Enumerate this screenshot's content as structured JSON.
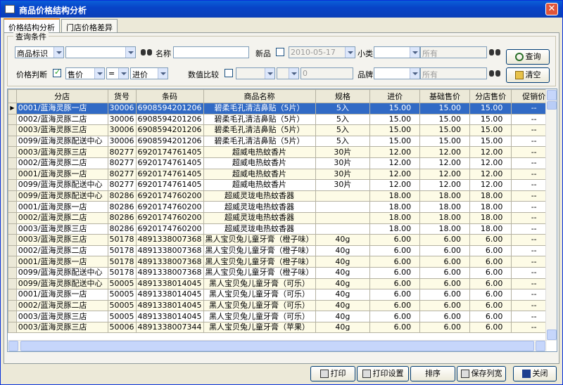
{
  "window": {
    "title": "商品价格结构分析",
    "close_glyph": "✕"
  },
  "tabs": [
    {
      "label": "价格结构分析",
      "active": true
    },
    {
      "label": "门店价格差异",
      "active": false
    }
  ],
  "query": {
    "legend": "查询条件",
    "goods_id_select": "商品标识",
    "goods_id_value": "",
    "name_label": "名称",
    "name_value": "",
    "new_label": "新品",
    "new_checked": false,
    "new_date": "2010-05-17",
    "subcat_label": "小类",
    "subcat_value": "",
    "subcat_all": "所有",
    "price_judge_label": "价格判断",
    "price_judge_checked": true,
    "price_left": "售价",
    "price_op": "=",
    "price_right": "进价",
    "value_compare_label": "数值比较",
    "value_compare_checked": false,
    "value_compare_value": "0",
    "brand_label": "品牌",
    "brand_value": "",
    "brand_all": "所有",
    "query_button": "查询",
    "clear_button": "清空"
  },
  "grid": {
    "columns": [
      "分店",
      "货号",
      "条码",
      "商品名称",
      "规格",
      "进价",
      "基础售价",
      "分店售价",
      "促销价"
    ],
    "rows": [
      [
        "0001/蓝海灵豚一店",
        "30006",
        "6908594201206",
        "碧柔毛孔清洁鼻贴（5片）",
        "5入",
        "15.00",
        "15.00",
        "15.00",
        "--"
      ],
      [
        "0002/蓝海灵豚二店",
        "30006",
        "6908594201206",
        "碧柔毛孔清洁鼻贴（5片）",
        "5入",
        "15.00",
        "15.00",
        "15.00",
        "--"
      ],
      [
        "0003/蓝海灵豚三店",
        "30006",
        "6908594201206",
        "碧柔毛孔清洁鼻贴（5片）",
        "5入",
        "15.00",
        "15.00",
        "15.00",
        "--"
      ],
      [
        "0099/蓝海灵豚配送中心",
        "30006",
        "6908594201206",
        "碧柔毛孔清洁鼻贴（5片）",
        "5入",
        "15.00",
        "15.00",
        "15.00",
        "--"
      ],
      [
        "0003/蓝海灵豚三店",
        "80277",
        "6920174761405",
        "超威电热蚊香片",
        "30片",
        "12.00",
        "12.00",
        "12.00",
        "--"
      ],
      [
        "0002/蓝海灵豚二店",
        "80277",
        "6920174761405",
        "超威电热蚊香片",
        "30片",
        "12.00",
        "12.00",
        "12.00",
        "--"
      ],
      [
        "0001/蓝海灵豚一店",
        "80277",
        "6920174761405",
        "超威电热蚊香片",
        "30片",
        "12.00",
        "12.00",
        "12.00",
        "--"
      ],
      [
        "0099/蓝海灵豚配送中心",
        "80277",
        "6920174761405",
        "超威电热蚊香片",
        "30片",
        "12.00",
        "12.00",
        "12.00",
        "--"
      ],
      [
        "0099/蓝海灵豚配送中心",
        "80286",
        "6920174760200",
        "超威灵珑电热蚊香器",
        "",
        "18.00",
        "18.00",
        "18.00",
        "--"
      ],
      [
        "0001/蓝海灵豚一店",
        "80286",
        "6920174760200",
        "超威灵珑电热蚊香器",
        "",
        "18.00",
        "18.00",
        "18.00",
        "--"
      ],
      [
        "0002/蓝海灵豚二店",
        "80286",
        "6920174760200",
        "超威灵珑电热蚊香器",
        "",
        "18.00",
        "18.00",
        "18.00",
        "--"
      ],
      [
        "0003/蓝海灵豚三店",
        "80286",
        "6920174760200",
        "超威灵珑电热蚊香器",
        "",
        "18.00",
        "18.00",
        "18.00",
        "--"
      ],
      [
        "0003/蓝海灵豚三店",
        "50178",
        "4891338007368",
        "黑人宝贝兔儿童牙膏（橙子味）",
        "40g",
        "6.00",
        "6.00",
        "6.00",
        "--"
      ],
      [
        "0002/蓝海灵豚二店",
        "50178",
        "4891338007368",
        "黑人宝贝兔儿童牙膏（橙子味）",
        "40g",
        "6.00",
        "6.00",
        "6.00",
        "--"
      ],
      [
        "0001/蓝海灵豚一店",
        "50178",
        "4891338007368",
        "黑人宝贝兔儿童牙膏（橙子味）",
        "40g",
        "6.00",
        "6.00",
        "6.00",
        "--"
      ],
      [
        "0099/蓝海灵豚配送中心",
        "50178",
        "4891338007368",
        "黑人宝贝兔儿童牙膏（橙子味）",
        "40g",
        "6.00",
        "6.00",
        "6.00",
        "--"
      ],
      [
        "0099/蓝海灵豚配送中心",
        "50005",
        "4891338014045",
        "黑人宝贝兔儿童牙膏（可乐）",
        "40g",
        "6.00",
        "6.00",
        "6.00",
        "--"
      ],
      [
        "0001/蓝海灵豚一店",
        "50005",
        "4891338014045",
        "黑人宝贝兔儿童牙膏（可乐）",
        "40g",
        "6.00",
        "6.00",
        "6.00",
        "--"
      ],
      [
        "0002/蓝海灵豚二店",
        "50005",
        "4891338014045",
        "黑人宝贝兔儿童牙膏（可乐）",
        "40g",
        "6.00",
        "6.00",
        "6.00",
        "--"
      ],
      [
        "0003/蓝海灵豚三店",
        "50005",
        "4891338014045",
        "黑人宝贝兔儿童牙膏（可乐）",
        "40g",
        "6.00",
        "6.00",
        "6.00",
        "--"
      ],
      [
        "0003/蓝海灵豚三店",
        "50006",
        "4891338007344",
        "黑人宝贝兔儿童牙膏（苹果）",
        "40g",
        "6.00",
        "6.00",
        "6.00",
        "--"
      ]
    ],
    "selected_row": 0,
    "row_indicator": "▶"
  },
  "buttons": {
    "print": "打印",
    "print_setup": "打印设置",
    "sort": "排序",
    "save_widths": "保存列宽",
    "close": "关闭"
  },
  "colors": {
    "title_bar": "#0a4fcc",
    "selection": "#316ac5",
    "row_alt": "#fdfbe6"
  }
}
